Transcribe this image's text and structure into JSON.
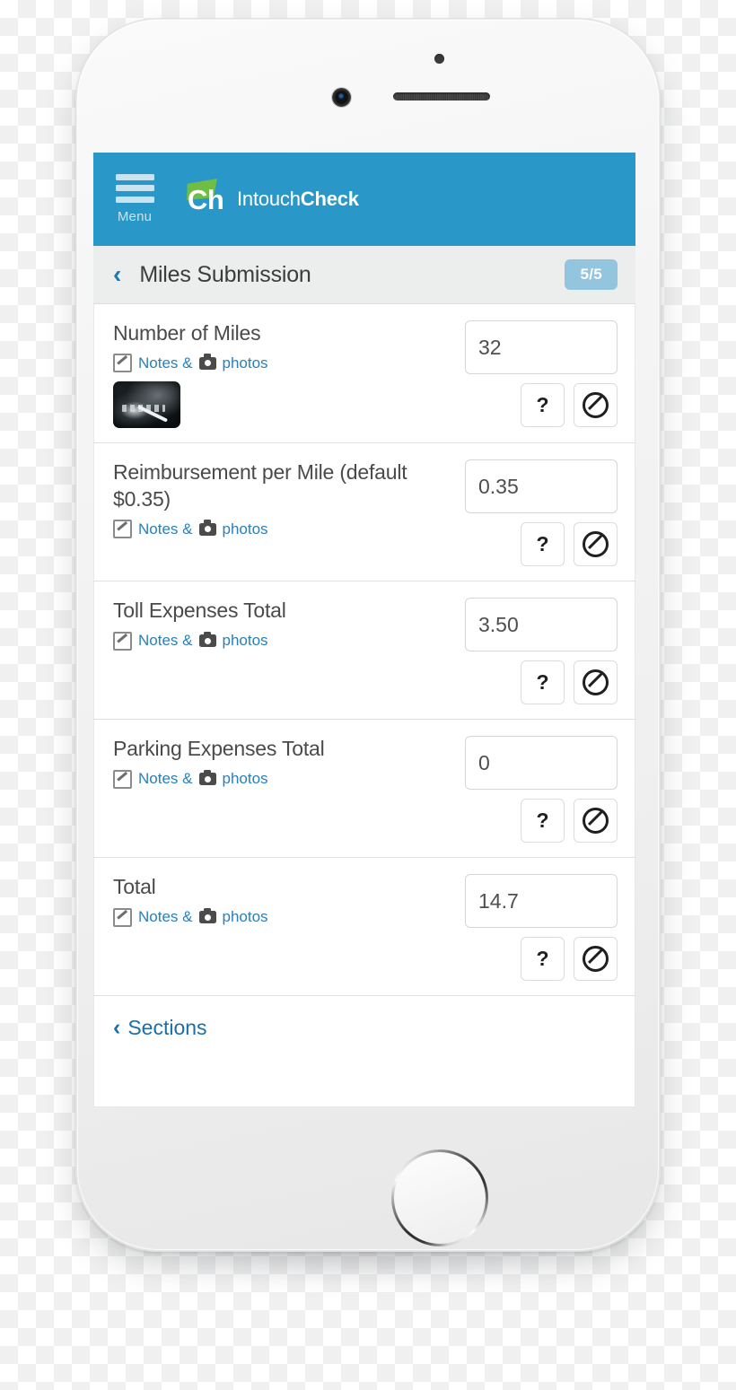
{
  "app": {
    "menu_label": "Menu",
    "brand_prefix": "Intouch",
    "brand_suffix": "Check",
    "brand_mark": "Ch",
    "header_color": "#2a97c9",
    "accent_green": "#6ebe44",
    "link_blue": "#2a7fb8"
  },
  "sub_header": {
    "back_chevron": "‹",
    "title": "Miles Submission",
    "progress": "5/5",
    "progress_color": "#93c6de"
  },
  "notes": {
    "notes_text": "Notes &",
    "photos_text": "photos"
  },
  "actions": {
    "help_label": "?",
    "na_label": "⊘"
  },
  "questions": [
    {
      "label": "Number of Miles",
      "value": "32",
      "has_photo": true
    },
    {
      "label": "Reimbursement per Mile (default $0.35)",
      "value": "0.35",
      "has_photo": false
    },
    {
      "label": "Toll Expenses Total",
      "value": "3.50",
      "has_photo": false
    },
    {
      "label": "Parking Expenses Total",
      "value": "0",
      "has_photo": false
    },
    {
      "label": "Total",
      "value": "14.7",
      "has_photo": false
    }
  ],
  "footer": {
    "chevron": "‹",
    "sections_label": "Sections"
  }
}
